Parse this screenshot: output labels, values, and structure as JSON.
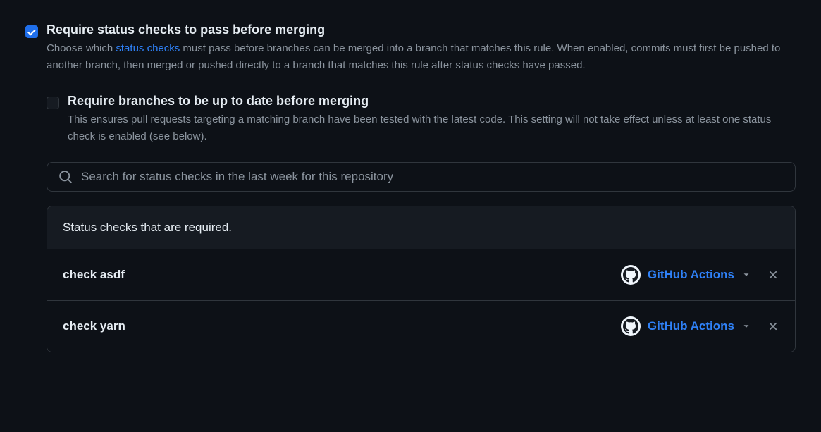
{
  "require_status": {
    "checked": true,
    "title": "Require status checks to pass before merging",
    "desc_before": "Choose which ",
    "link": "status checks",
    "desc_after": " must pass before branches can be merged into a branch that matches this rule. When enabled, commits must first be pushed to another branch, then merged or pushed directly to a branch that matches this rule after status checks have passed."
  },
  "require_uptodate": {
    "checked": false,
    "title": "Require branches to be up to date before merging",
    "desc": "This ensures pull requests targeting a matching branch have been tested with the latest code. This setting will not take effect unless at least one status check is enabled (see below)."
  },
  "search": {
    "placeholder": "Search for status checks in the last week for this repository"
  },
  "table": {
    "header": "Status checks that are required.",
    "rows": [
      {
        "name": "check asdf",
        "provider": "GitHub Actions"
      },
      {
        "name": "check yarn",
        "provider": "GitHub Actions"
      }
    ]
  }
}
